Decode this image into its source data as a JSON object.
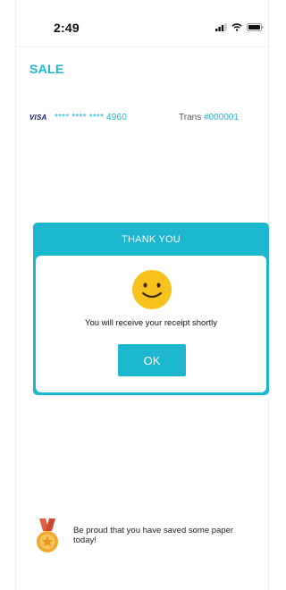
{
  "status_bar": {
    "time": "2:49",
    "signal_icon": "cellular-signal-icon",
    "wifi_icon": "wifi-icon",
    "battery_icon": "battery-icon"
  },
  "page": {
    "title": "SALE"
  },
  "transaction": {
    "card_brand": "VISA",
    "card_masked": "**** **** **** 4960",
    "trans_label": "Trans",
    "trans_number": "#000001"
  },
  "modal": {
    "header": "THANK YOU",
    "icon": "smiley-face-icon",
    "message": "You will receive your receipt shortly",
    "ok_label": "OK"
  },
  "footer": {
    "icon": "medal-icon",
    "message": "Be proud that you have saved some paper today!"
  },
  "colors": {
    "accent": "#1cb6cf",
    "smiley": "#f7c21c",
    "medal_ribbon": "#e35d3f",
    "medal": "#f0a830"
  }
}
